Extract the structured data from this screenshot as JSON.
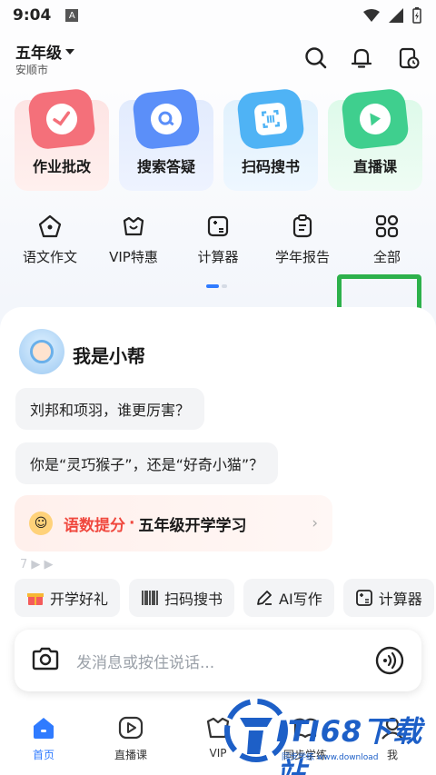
{
  "status_bar": {
    "time": "9:04",
    "notif_letter": "A"
  },
  "header": {
    "grade": "五年级",
    "city": "安顺市"
  },
  "big_tools": [
    {
      "label": "作业批改",
      "color": "#f4707a"
    },
    {
      "label": "搜索答疑",
      "color": "#5b8ff9"
    },
    {
      "label": "扫码搜书",
      "color": "#4fb3f5"
    },
    {
      "label": "直播课",
      "color": "#3fcf8e"
    }
  ],
  "small_tools": [
    {
      "label": "语文作文",
      "icon": "pencil-pentagon-icon"
    },
    {
      "label": "VIP特惠",
      "icon": "vip-bag-icon"
    },
    {
      "label": "计算器",
      "icon": "calculator-icon"
    },
    {
      "label": "学年报告",
      "icon": "clipboard-icon"
    },
    {
      "label": "全部",
      "icon": "grid-four-icon"
    }
  ],
  "chat": {
    "bot_name": "我是小帮",
    "bubbles": [
      "刘邦和项羽，谁更厉害？",
      "你是“灵巧猴子”，还是“好奇小猫”？"
    ],
    "promo": {
      "red": "语数提分",
      "dot": "·",
      "text": "五年级开学学习",
      "arrow": "›"
    },
    "faded": "7 ▶ ▶"
  },
  "chips": [
    {
      "label": "开学好礼",
      "icon": "gift-icon"
    },
    {
      "label": "扫码搜书",
      "icon": "barcode-icon"
    },
    {
      "label": "AI写作",
      "icon": "pen-icon"
    },
    {
      "label": "计算器",
      "icon": "calculator-icon"
    }
  ],
  "input": {
    "placeholder": "发消息或按住说话..."
  },
  "tabs": [
    {
      "label": "首页",
      "active": true
    },
    {
      "label": "直播课",
      "active": false
    },
    {
      "label": "VIP",
      "active": false
    },
    {
      "label": "同步学练",
      "active": false
    },
    {
      "label": "我",
      "active": false
    }
  ],
  "watermark": {
    "text": "ITI68下载站",
    "sub": "同步学练 www.download"
  },
  "colors": {
    "accent": "#2f7bff",
    "highlight": "#2db14b",
    "promo_red": "#f0483e"
  }
}
